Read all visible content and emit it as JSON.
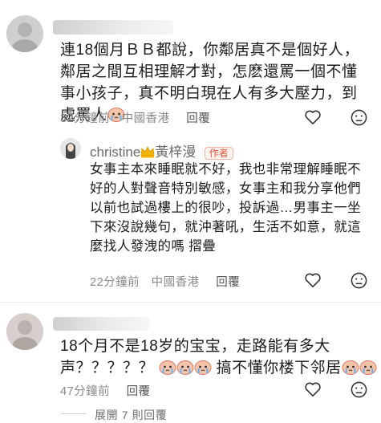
{
  "comments": [
    {
      "text": "連18個月ＢＢ都說，你鄰居真不是個好人，鄰居之間互相理解才對，怎麽還罵一個不懂事小孩子，真不明白現在人有多大壓力，到處罵人",
      "time": "32分鐘前",
      "location": "中國香港",
      "reply_label": "回覆",
      "author_reply": {
        "author": "christine",
        "author_suffix": "黃梓漫",
        "badge": "作者",
        "text": "女事主本來睡眠就不好，我也非常理解睡眠不好的人對聲音特別敏感，女事主和我分享他們以前也試過樓上的很吵，投訴過…男事主一坐下來沒說幾句，就沖著吼，生活不如意，就這麼找人發洩的嗎",
        "collapse_label": "摺疊",
        "time": "22分鐘前",
        "location": "中國香港",
        "reply_label": "回覆"
      }
    },
    {
      "text_line1": "18个月不是18岁的宝宝，走路能有多大",
      "text_line2_a": "声？？？？？",
      "text_line2_b": "搞不懂你楼下邻居",
      "time": "47分鐘前",
      "reply_label": "回覆"
    }
  ],
  "expand_label": "展開 7 則回覆",
  "icons": [
    "heart-icon",
    "dislike-face-icon",
    "crown-icon",
    "crying-emoji"
  ],
  "colors": {
    "badge": "#e8543a",
    "meta": "#8a8a8a"
  }
}
